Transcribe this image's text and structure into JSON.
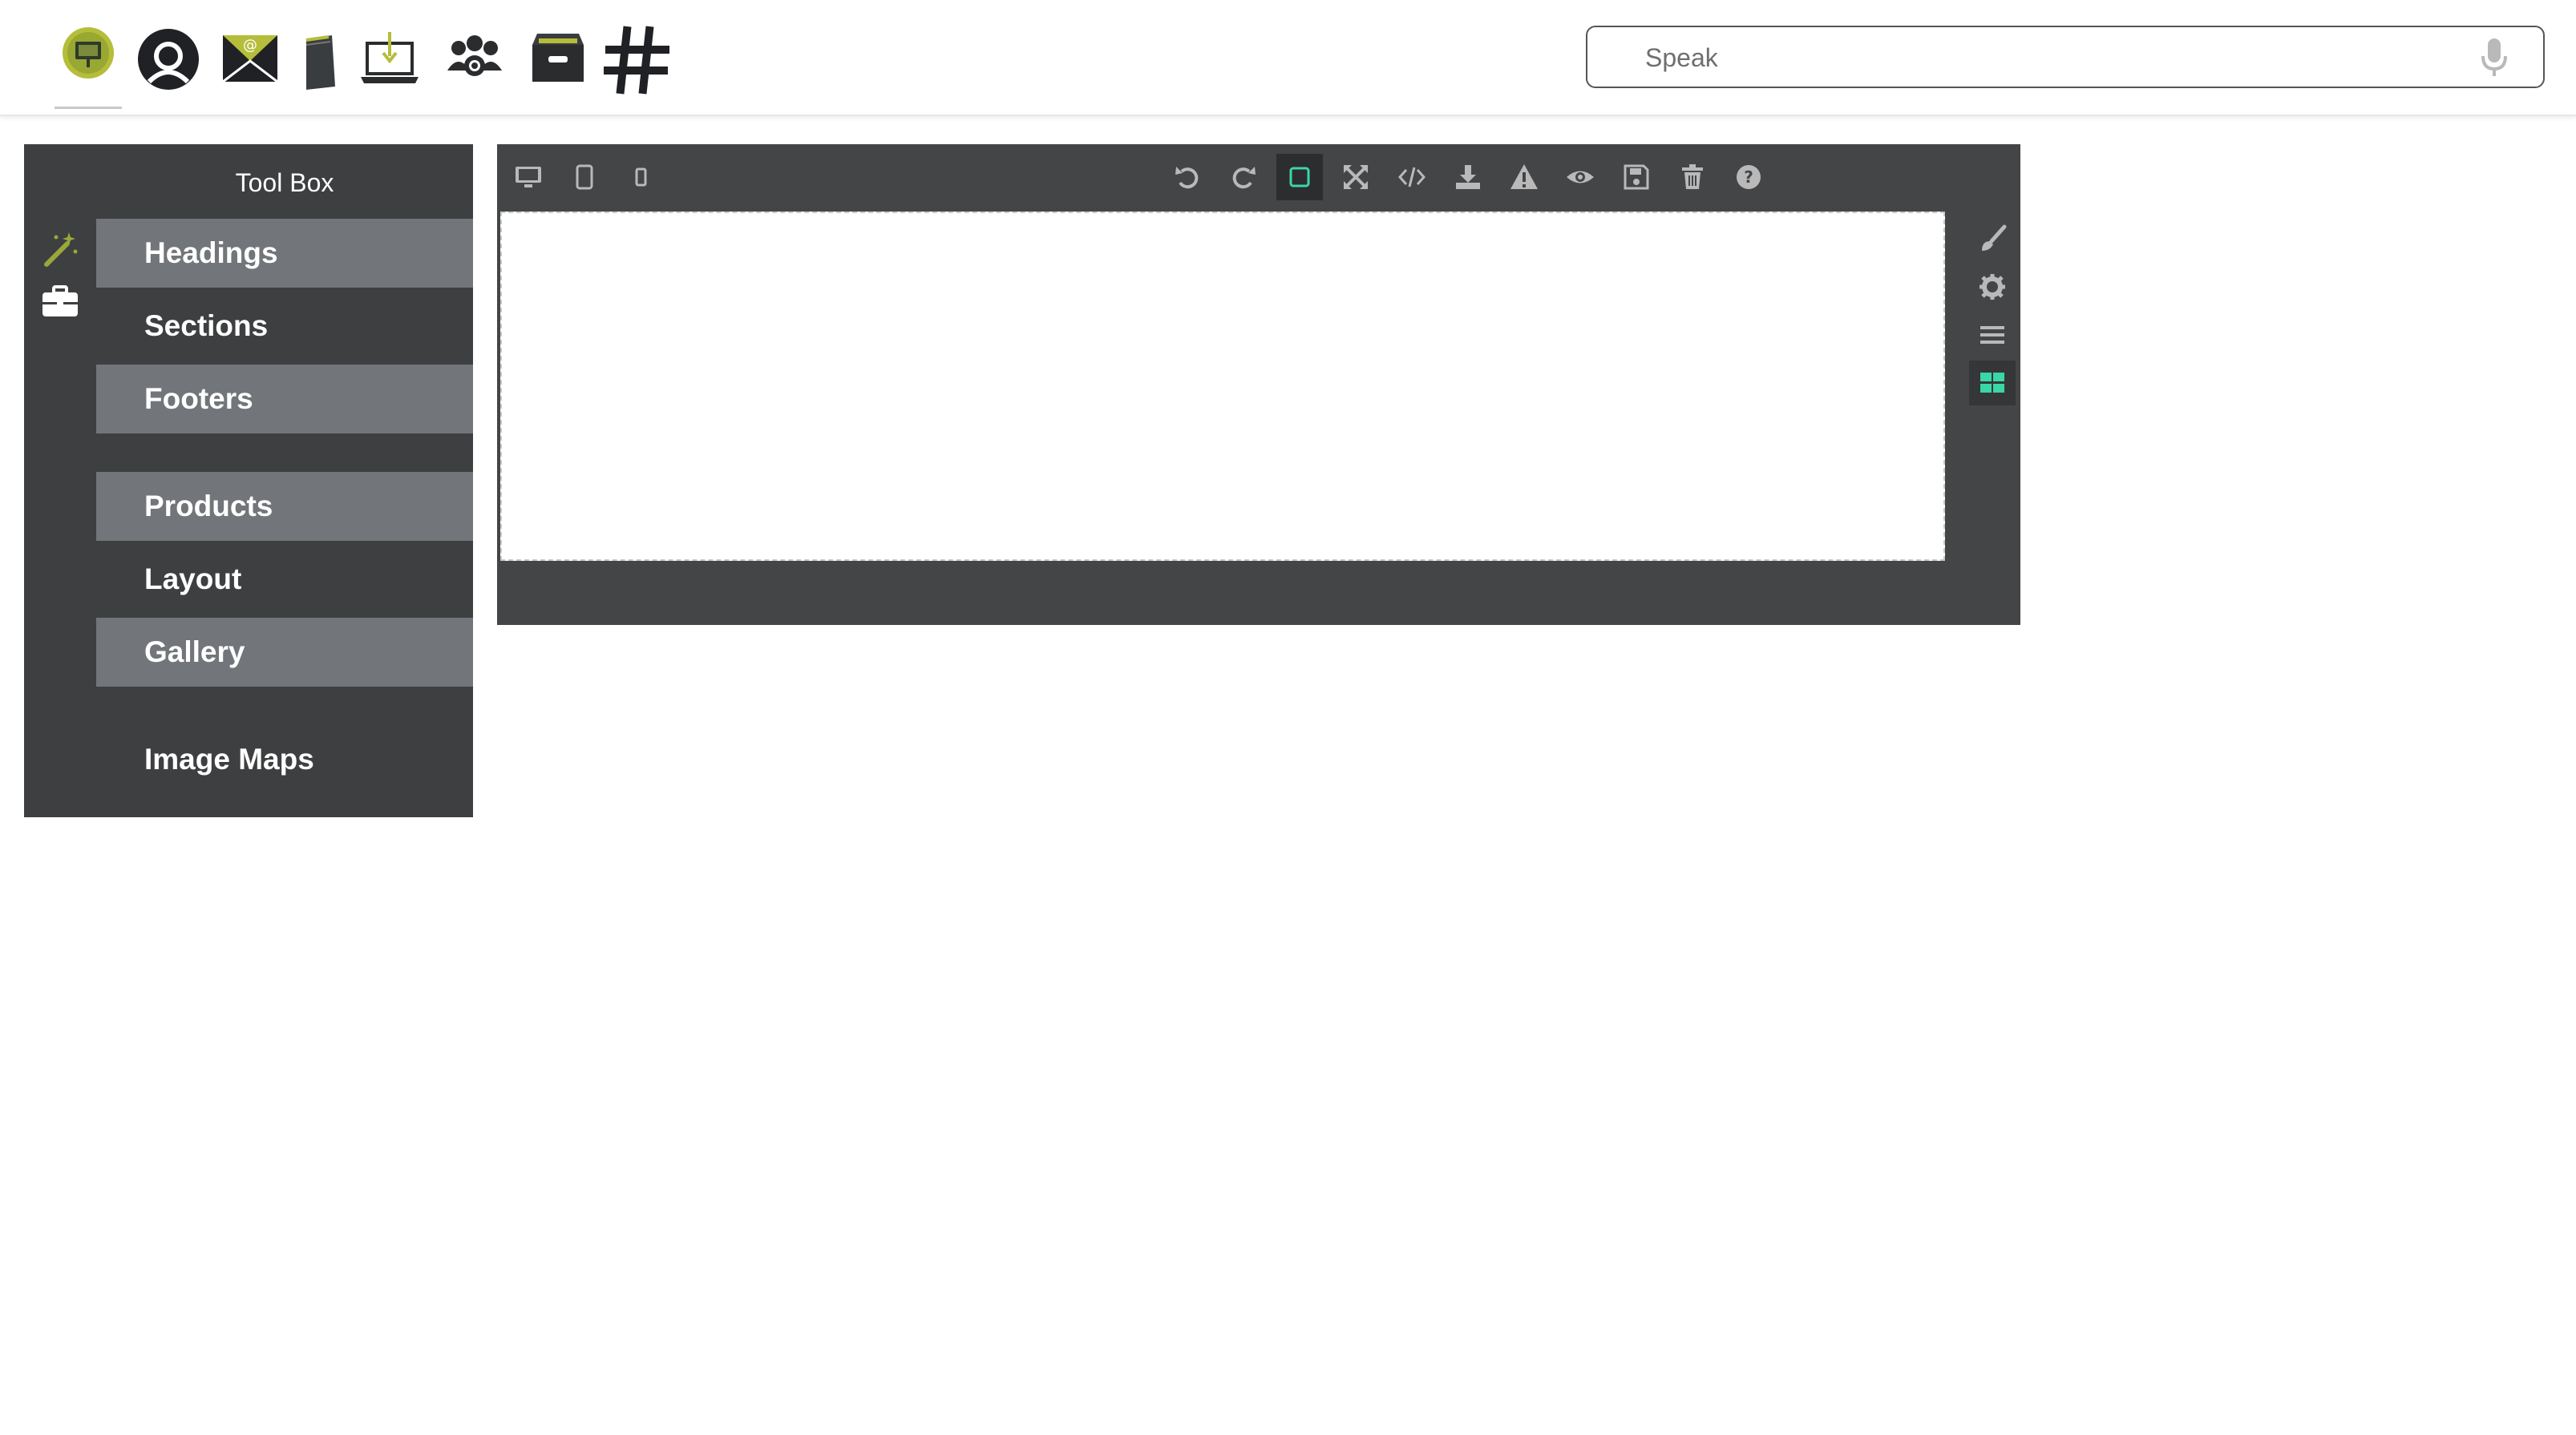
{
  "topbar": {
    "apps": [
      {
        "name": "presentation-app-icon"
      },
      {
        "name": "profile-app-icon"
      },
      {
        "name": "mail-app-icon"
      },
      {
        "name": "notebook-app-icon"
      },
      {
        "name": "laptop-app-icon"
      },
      {
        "name": "community-app-icon"
      },
      {
        "name": "archive-app-icon"
      },
      {
        "name": "hashtag-app-icon"
      }
    ],
    "search": {
      "placeholder": "Speak",
      "value": "",
      "icon": "microphone-icon"
    }
  },
  "toolbox": {
    "title": "Tool Box",
    "side_icons": [
      "magic-wand-icon",
      "briefcase-icon"
    ],
    "items": [
      {
        "label": "Headings",
        "shaded": true
      },
      {
        "label": "Sections",
        "shaded": false
      },
      {
        "label": "Footers",
        "shaded": true
      },
      {
        "label": "Products",
        "shaded": true
      },
      {
        "label": "Layout",
        "shaded": false
      },
      {
        "label": "Gallery",
        "shaded": true
      },
      {
        "label": "Image Maps",
        "shaded": false
      }
    ]
  },
  "editor": {
    "device_buttons": [
      "desktop-view-icon",
      "tablet-view-icon",
      "mobile-view-icon"
    ],
    "actions": [
      "undo-icon",
      "redo-icon",
      "component-outline-icon",
      "fullscreen-icon",
      "code-icon",
      "download-icon",
      "warning-icon",
      "preview-icon",
      "save-icon",
      "trash-icon",
      "help-icon"
    ],
    "active_action": "component-outline-icon",
    "panel_buttons": [
      "style-manager-icon",
      "settings-icon",
      "layer-manager-icon",
      "blocks-icon"
    ],
    "active_panel": "blocks-icon"
  },
  "colors": {
    "panel_bg": "#3e3f41",
    "item_shaded": "#72757a",
    "editor_bg": "#444546",
    "accent": "#3ad6a8",
    "icon_gray": "#b9b9b9",
    "app_olive": "#8a9a2e"
  }
}
